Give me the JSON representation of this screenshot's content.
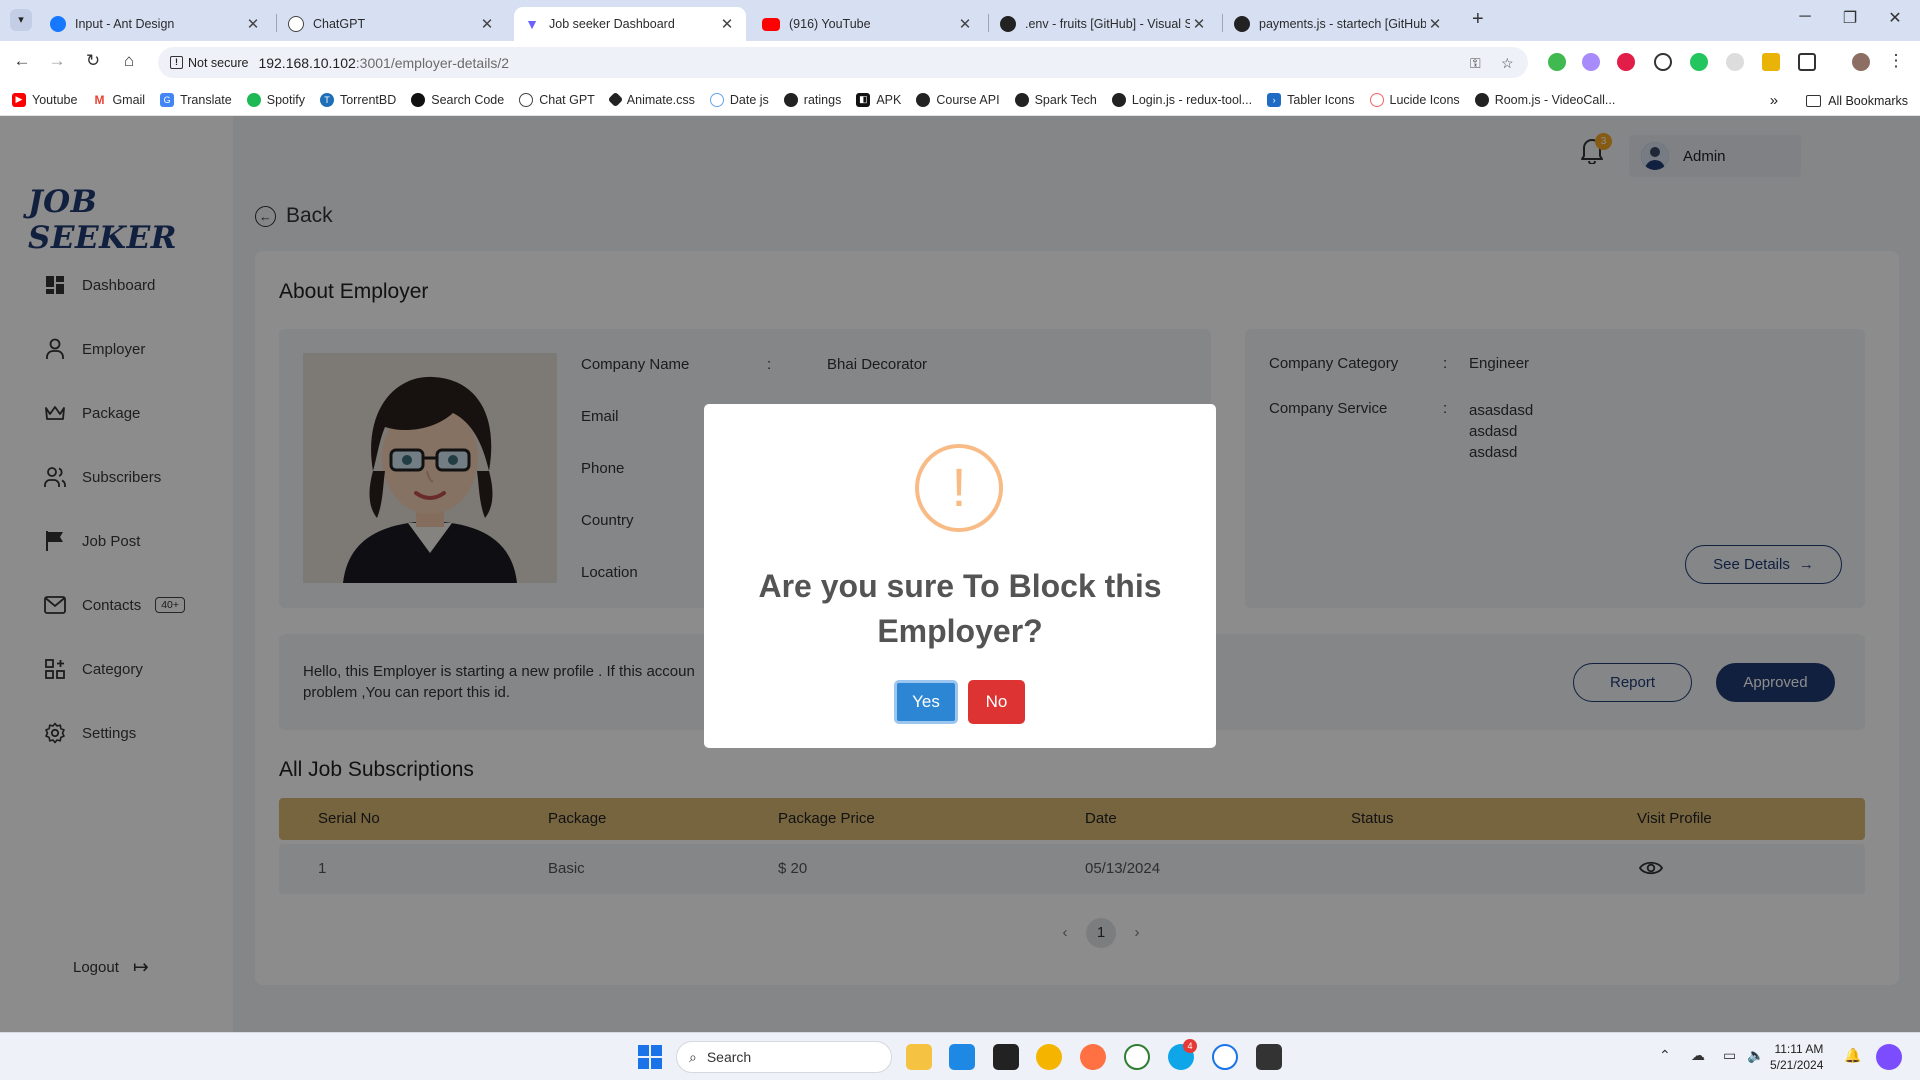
{
  "browser": {
    "tabs": [
      {
        "title": "Input - Ant Design",
        "color": "#1677ff"
      },
      {
        "title": "ChatGPT",
        "color": "#444"
      },
      {
        "title": "Job seeker Dashboard",
        "color": "#6c63ff"
      },
      {
        "title": "(916) YouTube",
        "color": "#ff0000"
      },
      {
        "title": ".env - fruits [GitHub] - Visual St",
        "color": "#222"
      },
      {
        "title": "payments.js - startech [GitHub]",
        "color": "#222"
      }
    ],
    "not_secure": "Not secure",
    "url_host": "192.168.10.102",
    "url_path": ":3001/employer-details/2",
    "bookmarks": [
      {
        "label": "Youtube",
        "color": "#ff0000"
      },
      {
        "label": "Gmail",
        "color": "#ea4335"
      },
      {
        "label": "Translate",
        "color": "#4285f4"
      },
      {
        "label": "Spotify",
        "color": "#1db954"
      },
      {
        "label": "TorrentBD",
        "color": "#1e6fb8"
      },
      {
        "label": "Search Code",
        "color": "#111"
      },
      {
        "label": "Chat GPT",
        "color": "#444"
      },
      {
        "label": "Animate.css",
        "color": "#222"
      },
      {
        "label": "Date js",
        "color": "#67a6e8"
      },
      {
        "label": "ratings",
        "color": "#222"
      },
      {
        "label": "APK",
        "color": "#111"
      },
      {
        "label": "Course API",
        "color": "#222"
      },
      {
        "label": "Spark Tech",
        "color": "#222"
      },
      {
        "label": "Login.js - redux-tool...",
        "color": "#222"
      },
      {
        "label": "Tabler Icons",
        "color": "#206bc4"
      },
      {
        "label": "Lucide Icons",
        "color": "#f56565"
      },
      {
        "label": "Room.js - VideoCall...",
        "color": "#222"
      }
    ],
    "all_bookmarks": "All Bookmarks"
  },
  "sidebar": {
    "logo": "JOB SEEKER",
    "items": [
      {
        "label": "Dashboard",
        "icon": "dashboard-icon"
      },
      {
        "label": "Employer",
        "icon": "user-icon"
      },
      {
        "label": "Package",
        "icon": "crown-icon"
      },
      {
        "label": "Subscribers",
        "icon": "users-icon"
      },
      {
        "label": "Job Post",
        "icon": "flag-icon"
      },
      {
        "label": "Contacts",
        "icon": "mail-icon",
        "badge": "40+"
      },
      {
        "label": "Category",
        "icon": "category-icon"
      },
      {
        "label": "Settings",
        "icon": "gear-icon"
      }
    ],
    "logout": "Logout"
  },
  "header": {
    "notification_count": "3",
    "user_name": "Admin"
  },
  "page": {
    "back": "Back",
    "title": "About Employer",
    "fields": [
      {
        "label": "Company Name",
        "value": "Bhai Decorator"
      },
      {
        "label": "Email",
        "value": ""
      },
      {
        "label": "Phone",
        "value": ""
      },
      {
        "label": "Country",
        "value": ""
      },
      {
        "label": "Location",
        "value": ""
      }
    ],
    "colon": ":",
    "category_label": "Company Category",
    "category_value": "Engineer",
    "service_label": "Company Service",
    "service_values": [
      "asasdasd",
      "asdasd",
      "asdasd"
    ],
    "see_details": "See Details",
    "note_line1": "Hello, this Employer is starting a new profile . If this accoun",
    "note_line2": "problem ,You can report this id.",
    "report": "Report",
    "approved": "Approved",
    "subscriptions_title": "All Job Subscriptions",
    "table": {
      "headers": [
        "Serial No",
        "Package",
        "Package Price",
        "Date",
        "Status",
        "Visit Profile"
      ],
      "rows": [
        {
          "serial": "1",
          "package": "Basic",
          "price": "$ 20",
          "date": "05/13/2024",
          "status": ""
        }
      ]
    },
    "pagination": {
      "prev": "‹",
      "current": "1",
      "next": "›"
    }
  },
  "modal": {
    "icon": "!",
    "title": "Are you sure To Block this Employer?",
    "yes": "Yes",
    "no": "No"
  },
  "taskbar": {
    "search_placeholder": "Search",
    "time": "11:11 AM",
    "date": "5/21/2024",
    "skype_badge": "4"
  },
  "colors": {
    "primary": "#1f3b73",
    "table_header": "#d9b873",
    "warning": "#f8bb86",
    "confirm": "#2d86d3",
    "cancel": "#dd3333"
  }
}
